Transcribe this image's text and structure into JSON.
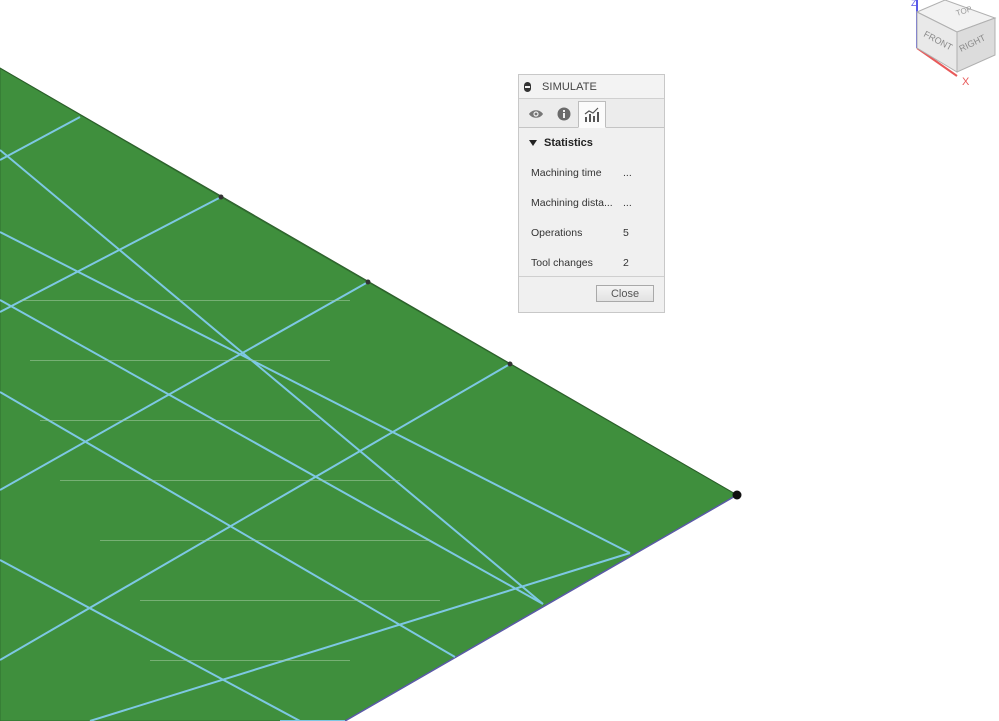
{
  "simulate_panel": {
    "title": "SIMULATE",
    "tabs": [
      {
        "name": "display-tab",
        "icon": "eye-icon"
      },
      {
        "name": "info-tab",
        "icon": "info-icon"
      },
      {
        "name": "statistics-tab",
        "icon": "statistics-chart-icon",
        "active": true
      }
    ],
    "section_title": "Statistics",
    "stats": [
      {
        "label": "Machining time",
        "value": "..."
      },
      {
        "label": "Machining dista...",
        "value": "..."
      },
      {
        "label": "Operations",
        "value": "5"
      },
      {
        "label": "Tool changes",
        "value": "2"
      }
    ],
    "close_label": "Close"
  },
  "viewcube": {
    "faces": {
      "top": "TOP",
      "front": "FRONT",
      "right": "RIGHT"
    },
    "axes": {
      "x": "X",
      "z": "Z"
    }
  },
  "colors": {
    "stock_green": "#3f8f3d",
    "grid_line": "#7ec8e3",
    "axis_x": "#e85a5a",
    "axis_z": "#5a5ae8"
  }
}
